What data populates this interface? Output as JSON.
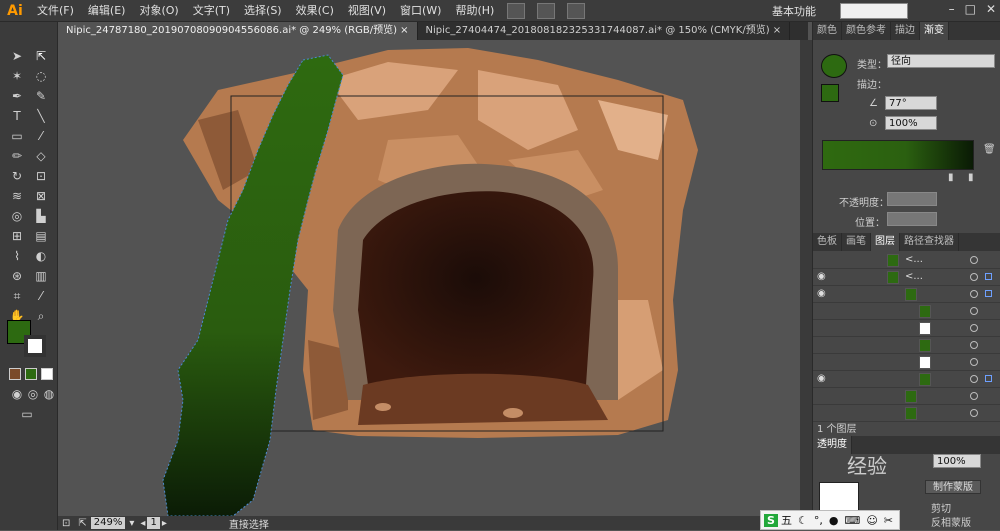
{
  "app": {
    "logo": "Ai",
    "menus": [
      "文件(F)",
      "编辑(E)",
      "对象(O)",
      "文字(T)",
      "选择(S)",
      "效果(C)",
      "视图(V)",
      "窗口(W)",
      "帮助(H)"
    ],
    "workspace": "基本功能",
    "window_controls": [
      "–",
      "□",
      "✕"
    ]
  },
  "tabs": [
    {
      "label": "Nipic_24787180_20190708090904556086.ai* @ 249% (RGB/预览)",
      "active": true
    },
    {
      "label": "Nipic_27404474_20180818232533174408​7.ai* @ 150% (CMYK/预览)",
      "active": false
    }
  ],
  "colors": {
    "fill": "#2d6a11",
    "grad_start": "#2f6a10",
    "grad_end": "#0a1a05",
    "accent": "#ff9a00"
  },
  "status": {
    "zoom": "249%",
    "page": "1",
    "tool": "直接选择"
  },
  "gradient_panel": {
    "tabs": [
      "颜色",
      "颜色参考",
      "描边",
      "渐变"
    ],
    "type_label": "类型：",
    "type_value": "径向",
    "stroke_label": "描边：",
    "angle": "77°",
    "scale": "100%",
    "opacity_label": "不透明度：",
    "position_label": "位置："
  },
  "layers_panel": {
    "tabs": [
      "色板",
      "画笔",
      "图层",
      "路径查找器"
    ],
    "rows": [
      {
        "name": "<...",
        "visible": false,
        "thumb": "green"
      },
      {
        "name": "<...",
        "visible": true,
        "thumb": "green"
      },
      {
        "name": "",
        "visible": true,
        "thumb": "green"
      },
      {
        "name": "",
        "visible": false,
        "thumb": "green"
      },
      {
        "name": "",
        "visible": false,
        "thumb": "white"
      },
      {
        "name": "",
        "visible": false,
        "thumb": "green"
      },
      {
        "name": "",
        "visible": false,
        "thumb": "white"
      },
      {
        "name": "",
        "visible": true,
        "thumb": "green"
      },
      {
        "name": "",
        "visible": false,
        "thumb": "green"
      },
      {
        "name": "",
        "visible": false,
        "thumb": "green"
      }
    ],
    "count": "1 个图层"
  },
  "bottom_panel": {
    "tab": "透明度",
    "opacity": "100%",
    "make_mask": "制作蒙版",
    "clip": "剪切",
    "invert_mask": "反相蒙版"
  },
  "watermark": "经验",
  "taskbar": {
    "ime": "五"
  }
}
